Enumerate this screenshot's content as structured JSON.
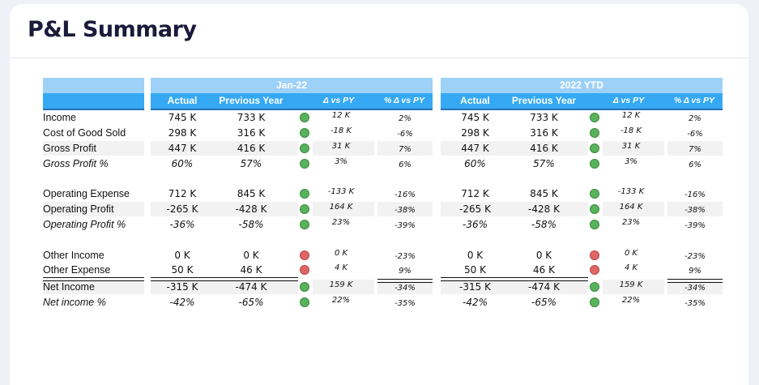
{
  "page": {
    "title": "P&L Summary"
  },
  "periods": [
    {
      "label": "Jan-22"
    },
    {
      "label": "2022 YTD"
    }
  ],
  "columns": {
    "actual": "Actual",
    "previous_year": "Previous Year",
    "delta": "Δ vs PY",
    "pct_delta": "% Δ vs PY"
  },
  "rows": [
    {
      "label": "Income",
      "italic": false,
      "actual": "745 K",
      "py": "733 K",
      "delta": "12 K",
      "pct": "2%",
      "status": "green"
    },
    {
      "label": "Cost of Good Sold",
      "italic": false,
      "actual": "298 K",
      "py": "316 K",
      "delta": "-18 K",
      "pct": "-6%",
      "status": "green"
    },
    {
      "label": "Gross Profit",
      "italic": false,
      "actual": "447 K",
      "py": "416 K",
      "delta": "31 K",
      "pct": "7%",
      "status": "green"
    },
    {
      "label": "Gross Profit %",
      "italic": true,
      "actual": "60%",
      "py": "57%",
      "delta": "3%",
      "pct": "6%",
      "status": "green"
    },
    {
      "label": "Operating Expense",
      "italic": false,
      "actual": "712 K",
      "py": "845 K",
      "delta": "-133 K",
      "pct": "-16%",
      "status": "green"
    },
    {
      "label": "Operating Profit",
      "italic": false,
      "actual": "-265 K",
      "py": "-428 K",
      "delta": "164 K",
      "pct": "-38%",
      "status": "green"
    },
    {
      "label": "Operating Profit %",
      "italic": true,
      "actual": "-36%",
      "py": "-58%",
      "delta": "23%",
      "pct": "-39%",
      "status": "green"
    },
    {
      "label": "Other Income",
      "italic": false,
      "actual": "0 K",
      "py": "0 K",
      "delta": "0 K",
      "pct": "-23%",
      "status": "red"
    },
    {
      "label": "Other Expense",
      "italic": false,
      "actual": "50 K",
      "py": "46 K",
      "delta": "4 K",
      "pct": "9%",
      "status": "red"
    },
    {
      "label": "Net Income",
      "italic": false,
      "actual": "-315 K",
      "py": "-474 K",
      "delta": "159 K",
      "pct": "-34%",
      "status": "green"
    },
    {
      "label": "Net income %",
      "italic": true,
      "actual": "-42%",
      "py": "-65%",
      "delta": "22%",
      "pct": "-35%",
      "status": "green"
    }
  ]
}
